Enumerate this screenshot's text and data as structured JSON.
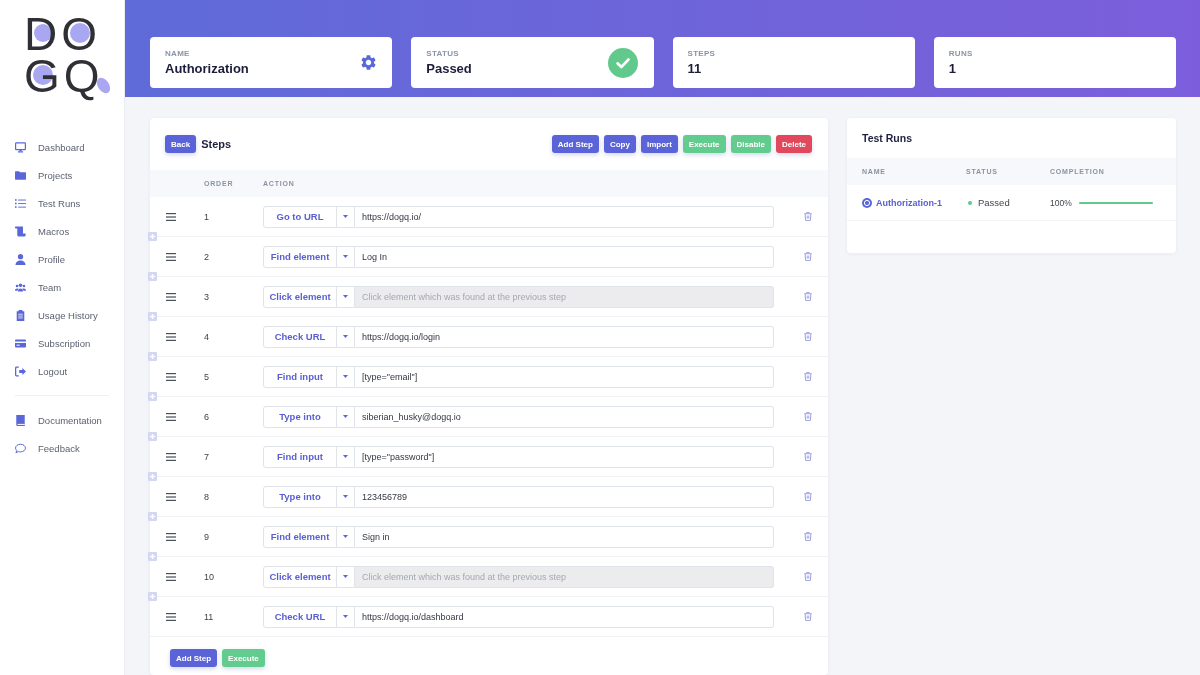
{
  "logo": {
    "lines": [
      "DO",
      "GQ"
    ]
  },
  "sidebar": {
    "items": [
      {
        "label": "Dashboard"
      },
      {
        "label": "Projects"
      },
      {
        "label": "Test Runs"
      },
      {
        "label": "Macros"
      },
      {
        "label": "Profile"
      },
      {
        "label": "Team"
      },
      {
        "label": "Usage History"
      },
      {
        "label": "Subscription"
      },
      {
        "label": "Logout"
      }
    ],
    "secondary_items": [
      {
        "label": "Documentation"
      },
      {
        "label": "Feedback"
      }
    ]
  },
  "summary_cards": [
    {
      "label": "NAME",
      "value": "Authorization",
      "kind": "settings"
    },
    {
      "label": "STATUS",
      "value": "Passed",
      "kind": "status"
    },
    {
      "label": "STEPS",
      "value": "11",
      "kind": "count"
    },
    {
      "label": "RUNS",
      "value": "1",
      "kind": "count"
    }
  ],
  "steps_panel": {
    "back_button": "Back",
    "title": "Steps",
    "toolbar": [
      {
        "label": "Add Step",
        "kind": "primary"
      },
      {
        "label": "Copy",
        "kind": "primary"
      },
      {
        "label": "Import",
        "kind": "primary"
      },
      {
        "label": "Execute",
        "kind": "success"
      },
      {
        "label": "Disable",
        "kind": "success"
      },
      {
        "label": "Delete",
        "kind": "danger"
      }
    ],
    "columns": [
      "ORDER",
      "ACTION"
    ],
    "rows": [
      {
        "order": "1",
        "action": "Go to URL",
        "value": "https://dogq.io/",
        "disabled": false
      },
      {
        "order": "2",
        "action": "Find element",
        "value": "Log In",
        "disabled": false
      },
      {
        "order": "3",
        "action": "Click element",
        "placeholder": "Click element which was found at the previous step",
        "disabled": true
      },
      {
        "order": "4",
        "action": "Check URL",
        "value": "https://dogq.io/login",
        "disabled": false
      },
      {
        "order": "5",
        "action": "Find input",
        "value": "[type=\"email\"]",
        "disabled": false
      },
      {
        "order": "6",
        "action": "Type into",
        "value": "siberian_husky@dogq.io",
        "disabled": false
      },
      {
        "order": "7",
        "action": "Find input",
        "value": "[type=\"password\"]",
        "disabled": false
      },
      {
        "order": "8",
        "action": "Type into",
        "value": "123456789",
        "disabled": false
      },
      {
        "order": "9",
        "action": "Find element",
        "value": "Sign in",
        "disabled": false
      },
      {
        "order": "10",
        "action": "Click element",
        "placeholder": "Click element which was found at the previous step",
        "disabled": true
      },
      {
        "order": "11",
        "action": "Check URL",
        "value": "https://dogq.io/dashboard",
        "disabled": false
      }
    ],
    "footer_buttons": [
      {
        "label": "Add Step",
        "kind": "primary"
      },
      {
        "label": "Execute",
        "kind": "success"
      }
    ]
  },
  "test_runs": {
    "title": "Test Runs",
    "columns": [
      "NAME",
      "STATUS",
      "COMPLETION"
    ],
    "rows": [
      {
        "name": "Authorization-1",
        "status": "Passed",
        "color": "#5ec98c",
        "completion": "100%",
        "level": 1
      }
    ]
  }
}
